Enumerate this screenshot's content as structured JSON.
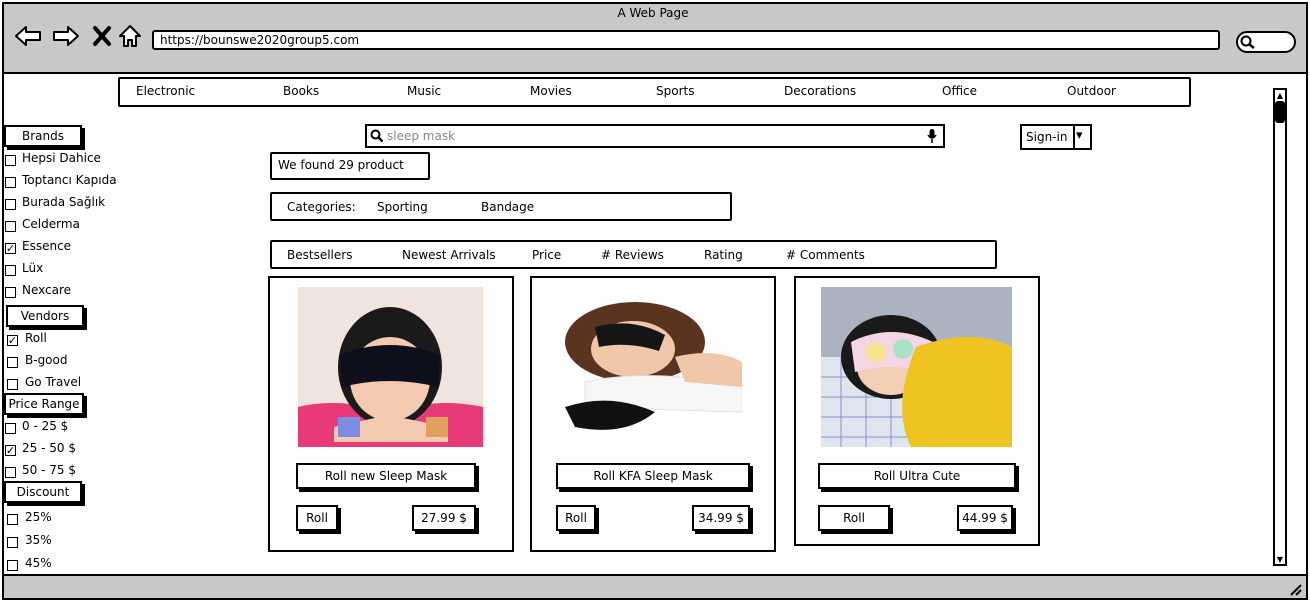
{
  "browser": {
    "title": "A Web Page",
    "url": "https://bounswe2020group5.com"
  },
  "nav": {
    "items": [
      "Electronic",
      "Books",
      "Music",
      "Movies",
      "Sports",
      "Decorations",
      "Office",
      "Outdoor"
    ]
  },
  "search": {
    "value": "sleep mask"
  },
  "signin": {
    "label": "Sign-in",
    "caret": "▾"
  },
  "results": {
    "count_text": "We found 29 product"
  },
  "categories": {
    "label": "Categories:",
    "items": [
      "Sporting",
      "Bandage"
    ]
  },
  "sort": {
    "items": [
      "Bestsellers",
      "Newest Arrivals",
      "Price",
      "# Reviews",
      "Rating",
      "# Comments"
    ]
  },
  "sidebar": {
    "brands": {
      "title": "Brands",
      "items": [
        {
          "label": "Hepsi Dahice",
          "checked": false
        },
        {
          "label": "Toptancı Kapıda",
          "checked": false
        },
        {
          "label": "Burada Sağlık",
          "checked": false
        },
        {
          "label": "Celderma",
          "checked": false
        },
        {
          "label": "Essence",
          "checked": true
        },
        {
          "label": "Lüx",
          "checked": false
        },
        {
          "label": "Nexcare",
          "checked": false
        }
      ]
    },
    "vendors": {
      "title": "Vendors",
      "items": [
        {
          "label": "Roll",
          "checked": true
        },
        {
          "label": "B-good",
          "checked": false
        },
        {
          "label": "Go Travel",
          "checked": false
        }
      ]
    },
    "price": {
      "title": "Price Range",
      "items": [
        {
          "label": "0 - 25 $",
          "checked": false
        },
        {
          "label": "25 - 50 $",
          "checked": true
        },
        {
          "label": "50 - 75 $",
          "checked": false
        }
      ]
    },
    "discount": {
      "title": "Discount",
      "items": [
        {
          "label": "25%",
          "checked": false
        },
        {
          "label": "35%",
          "checked": false
        },
        {
          "label": "45%",
          "checked": false
        }
      ]
    }
  },
  "products": [
    {
      "name": "Roll new Sleep Mask",
      "vendor": "Roll",
      "price": "27.99 $"
    },
    {
      "name": "Roll KFA Sleep Mask",
      "vendor": "Roll",
      "price": "34.99 $"
    },
    {
      "name": "Roll Ultra Cute",
      "vendor": "Roll",
      "price": "44.99 $"
    }
  ],
  "icons": {
    "back": "back-arrow-icon",
    "forward": "forward-arrow-icon",
    "close": "close-icon",
    "home": "home-icon",
    "search": "search-icon",
    "mic": "microphone-icon",
    "resize": "resize-grip-icon"
  }
}
